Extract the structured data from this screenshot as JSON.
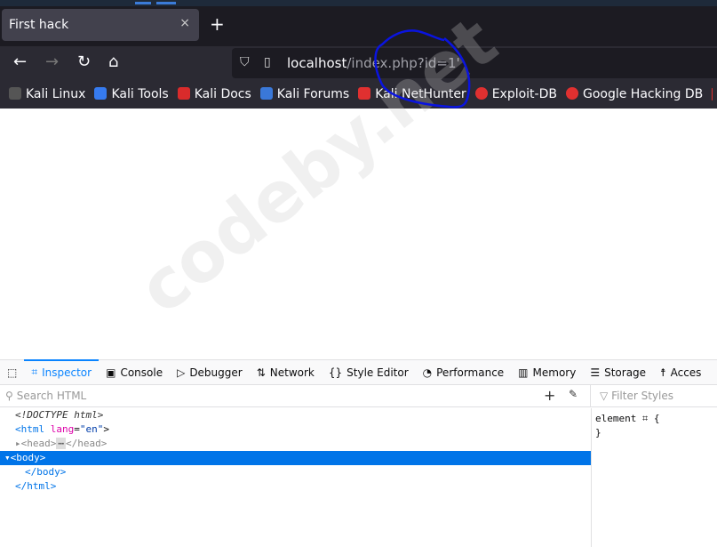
{
  "tab": {
    "title": "First hack",
    "close": "×",
    "new_tab": "+"
  },
  "nav": {
    "back": "←",
    "forward": "→",
    "reload": "↻",
    "home": "⌂",
    "url_host": "localhost",
    "url_path": "/index.php?id=1'"
  },
  "bookmarks": [
    {
      "label": "Kali Linux",
      "color": "#2b2a33"
    },
    {
      "label": "Kali Tools",
      "color": "#367bf0"
    },
    {
      "label": "Kali Docs",
      "color": "#d92b2b"
    },
    {
      "label": "Kali Forums",
      "color": "#3a78d8"
    },
    {
      "label": "Kali NetHunter",
      "color": "#e03030"
    },
    {
      "label": "Exploit-DB",
      "color": "#e03030"
    },
    {
      "label": "Google Hacking DB",
      "color": "#e03030"
    }
  ],
  "devtools": {
    "tools": [
      "Inspector",
      "Console",
      "Debugger",
      "Network",
      "Style Editor",
      "Performance",
      "Memory",
      "Storage",
      "Acces"
    ],
    "search_placeholder": "Search HTML",
    "filter_placeholder": "Filter Styles",
    "tree": {
      "doctype": "<!DOCTYPE html>",
      "html_open": "<html",
      "lang_attr": "lang",
      "lang_val": "\"en\"",
      "head": "<head>",
      "head_close": "</head>",
      "body_open": "<body>",
      "body_close": "</body>",
      "html_close": "</html>"
    },
    "rules": {
      "selector": "element",
      "open": "{",
      "close": "}"
    }
  },
  "watermark": "codeby.net",
  "accent": "#0a84ff",
  "annotation_color": "#0a14e0"
}
